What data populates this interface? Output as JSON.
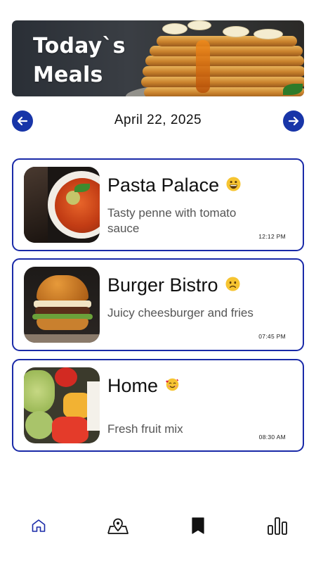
{
  "banner": {
    "title_line1": "Today`s",
    "title_line2": "Meals"
  },
  "date_nav": {
    "date": "April 22,  2025",
    "prev_icon": "arrow-left-icon",
    "next_icon": "arrow-right-icon"
  },
  "meals": [
    {
      "title": "Pasta Palace",
      "description": "Tasty penne with tomato sauce",
      "time": "12:12 PM",
      "emoji": "grinning-face-icon"
    },
    {
      "title": "Burger Bistro",
      "description": "Juicy cheesburger and fries",
      "time": "07:45 PM",
      "emoji": "slightly-frowning-face-icon"
    },
    {
      "title": "Home",
      "description": "Fresh fruit mix",
      "time": "08:30 AM",
      "emoji": "smiling-face-with-hearts-icon"
    }
  ],
  "bottom_nav": {
    "items": [
      {
        "icon": "home-icon",
        "active": true
      },
      {
        "icon": "map-pin-icon",
        "active": false
      },
      {
        "icon": "bookmark-icon",
        "active": false
      },
      {
        "icon": "bar-chart-icon",
        "active": false
      }
    ]
  },
  "colors": {
    "accent": "#1a2aa8",
    "nav_circle": "#1835a8",
    "text": "#111111",
    "muted": "#555555"
  }
}
